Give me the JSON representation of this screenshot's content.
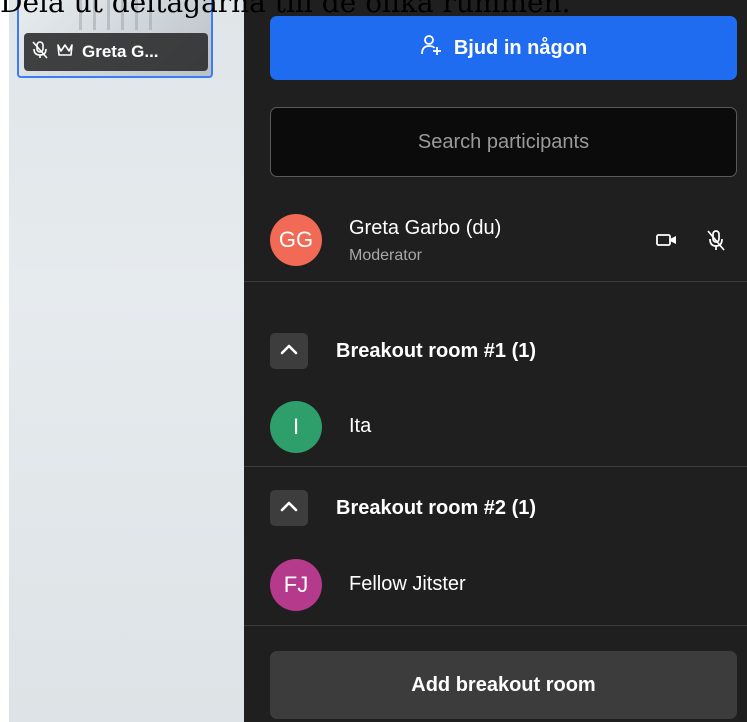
{
  "caption": "Dela ut deltagarna till de olika rummen.",
  "tile": {
    "name_label": "Greta G..."
  },
  "panel": {
    "invite_label": "Bjud in någon",
    "search_placeholder": "Search participants",
    "me": {
      "initials": "GG",
      "name": "Greta Garbo (du)",
      "role": "Moderator",
      "avatar_color": "#f16a55"
    },
    "rooms": [
      {
        "title": "Breakout room #1 (1)",
        "members": [
          {
            "initials": "I",
            "name": "Ita",
            "avatar_color": "#2e9e6b"
          }
        ]
      },
      {
        "title": "Breakout room #2 (1)",
        "members": [
          {
            "initials": "FJ",
            "name": "Fellow Jitster",
            "avatar_color": "#b53a8c"
          }
        ]
      }
    ],
    "add_room_label": "Add breakout room"
  },
  "colors": {
    "panel_bg": "#1f1f1f",
    "primary_button": "#1f6cf0",
    "secondary_button": "#3c3c3c",
    "tile_border": "#3e7cf5"
  },
  "icons": {
    "tile": [
      "mic-off-icon",
      "crown-icon"
    ],
    "invite": "add-person-icon",
    "me_controls": [
      "camera-icon",
      "mic-off-icon"
    ],
    "room_toggle": "chevron-up-icon"
  }
}
